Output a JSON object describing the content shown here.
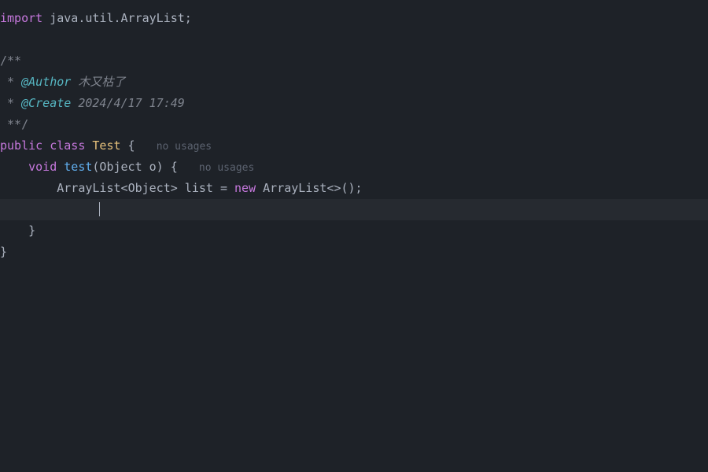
{
  "code": {
    "kw_import": "import",
    "import_stmt": " java.util.ArrayList;",
    "doc_open": "/**",
    "doc_star1": " * ",
    "doc_tag_author": "@Author",
    "doc_author_val": " 木又枯了",
    "doc_star2": " * ",
    "doc_tag_create": "@Create",
    "doc_create_val": " 2024/4/17 17:49",
    "doc_close": " **/",
    "kw_public": "public",
    "kw_class": "class",
    "class_name": "Test",
    "brace_open": " {",
    "hint_usages1": "no usages",
    "kw_void": "void",
    "method_name": "test",
    "method_params": "(Object o) {",
    "hint_usages2": "no usages",
    "type_arraylist": "ArrayList",
    "generic_open": "<",
    "generic_type": "Object",
    "generic_close": ">",
    "var_name": " list ",
    "eq": "= ",
    "kw_new": "new",
    "ctor": " ArrayList",
    "ctor_generic": "<>();",
    "brace_close_inner": "    }",
    "brace_close_outer": "}"
  }
}
